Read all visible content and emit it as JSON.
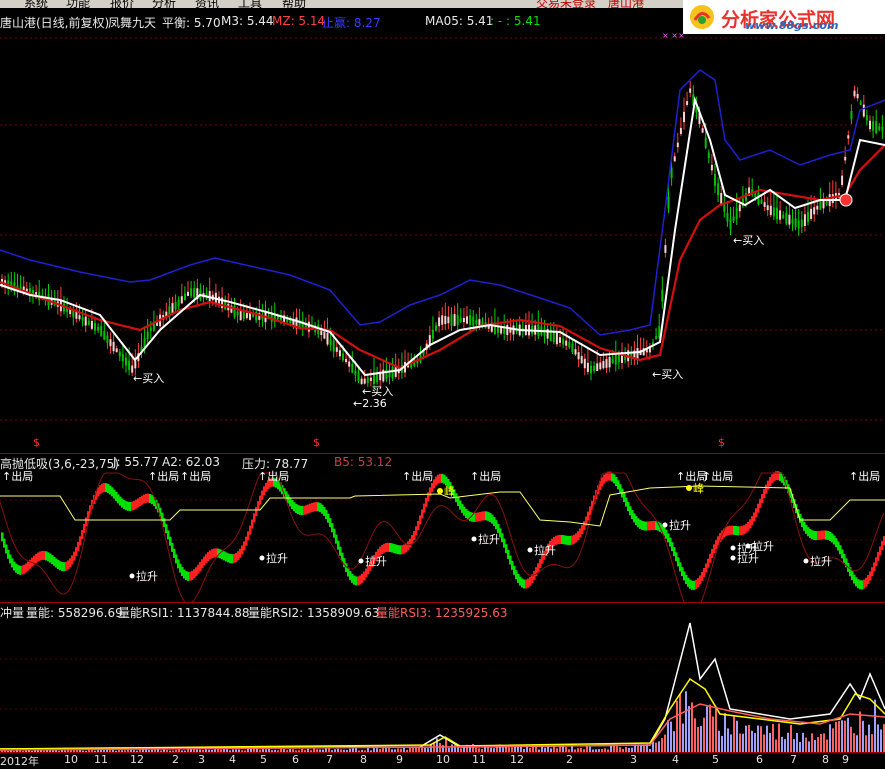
{
  "menu": {
    "items": [
      "系统",
      "功能",
      "报价",
      "分析",
      "资讯",
      "工具",
      "帮助"
    ],
    "status_text": "交易未登录",
    "status_user": "唐山港"
  },
  "logo": {
    "text": "分析家公式网",
    "url": "www.88gs.com"
  },
  "main_panel": {
    "title": "唐山港(日线,前复权)",
    "indicator_name": "凤舞九天",
    "items": [
      {
        "label": "平衡: 5.70",
        "color": "#e8e8e8"
      },
      {
        "label": "M3: 5.44",
        "color": "#e8e8e8"
      },
      {
        "label": "MZ: 5.14",
        "color": "#ff4040"
      },
      {
        "label": "止赢: 8.27",
        "color": "#3a3aff"
      },
      {
        "label": "MA05: 5.41",
        "color": "#e8e8e8"
      },
      {
        "label": ": - : 5.41",
        "color": "#00e000"
      }
    ],
    "annotations": [
      {
        "text": "←买入"
      },
      {
        "text": "←买入"
      },
      {
        "text": "←2.36"
      },
      {
        "text": "←买入"
      },
      {
        "text": "←买入"
      }
    ],
    "dividend_marker": "$"
  },
  "sub_panel_1": {
    "title": "高抛低吸(3,6,-23,75)",
    "items": [
      {
        "label": "J: 55.77",
        "color": "#e8e8e8"
      },
      {
        "label": "A2: 62.03",
        "color": "#e8e8e8"
      },
      {
        "label": "压力: 78.77",
        "color": "#e8e8e8"
      },
      {
        "label": "B5: 53.12",
        "color": "#c84040"
      }
    ],
    "labels": {
      "out": "↑出局",
      "up": "拉升",
      "peak": "峰"
    }
  },
  "sub_panel_2": {
    "title": "冲量",
    "items": [
      {
        "label": "量能: 558296.69",
        "color": "#e8e8e8"
      },
      {
        "label": "量能RSI1: 1137844.88",
        "color": "#e8e8e8"
      },
      {
        "label": "量能RSI2: 1358909.63",
        "color": "#e8e8e8"
      },
      {
        "label": "量能RSI3: 1235925.63",
        "color": "#ff5c5c"
      }
    ]
  },
  "time_axis": {
    "year_label": "2012年",
    "ticks": [
      "10",
      "11",
      "12",
      "2",
      "3",
      "4",
      "5",
      "6",
      "7",
      "8",
      "9",
      "10",
      "11",
      "12",
      "2",
      "3",
      "4",
      "5",
      "6",
      "7",
      "8",
      "9"
    ]
  }
}
